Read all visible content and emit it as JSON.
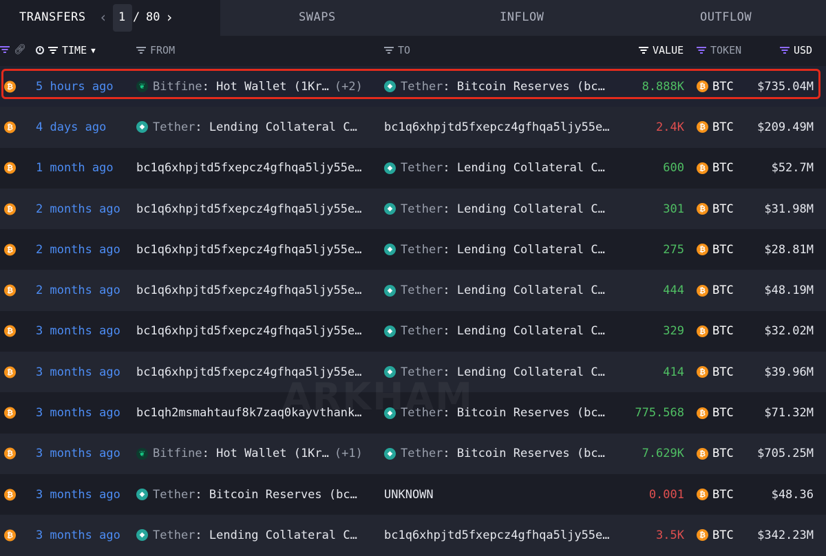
{
  "tabs": {
    "transfers": "TRANSFERS",
    "page_current": "1",
    "page_sep": "/",
    "page_total": "80",
    "prev_icon": "chevron-left-icon",
    "next_icon": "chevron-right-icon",
    "swaps": "SWAPS",
    "inflow": "INFLOW",
    "outflow": "OUTFLOW"
  },
  "header": {
    "time": "TIME",
    "from": "FROM",
    "to": "TO",
    "value": "VALUE",
    "token": "TOKEN",
    "usd": "USD"
  },
  "watermark": "ARKHAM",
  "colors": {
    "time_link": "#4d8df5",
    "positive": "#4fbf63",
    "negative": "#e04f4f",
    "btc": "#f7931a",
    "tether": "#26a59a",
    "highlight_border": "#e32b1c",
    "filter_accent": "#8f6bff"
  },
  "rows": [
    {
      "time": "5 hours ago",
      "from_entity": "Bitfine",
      "from_rest": ": Hot Wallet (1Kr…",
      "from_extra": "(+2)",
      "from_icon": "bitfinex-icon",
      "to_entity": "Tether",
      "to_rest": ": Bitcoin Reserves (bc…",
      "to_icon": "tether-icon",
      "value": "8.888K",
      "value_color": "green",
      "token": "BTC",
      "usd": "$735.04M",
      "highlight": true
    },
    {
      "time": "4 days ago",
      "from_entity": "Tether",
      "from_rest": ": Lending Collateral C…",
      "from_icon": "tether-icon",
      "to_plain": "bc1q6xhpjtd5fxepcz4gfhqa5ljy55e…",
      "value": "2.4K",
      "value_color": "red",
      "token": "BTC",
      "usd": "$209.49M"
    },
    {
      "time": "1 month ago",
      "from_plain": "bc1q6xhpjtd5fxepcz4gfhqa5ljy55e…",
      "to_entity": "Tether",
      "to_rest": ": Lending Collateral C…",
      "to_icon": "tether-icon",
      "value": "600",
      "value_color": "green",
      "token": "BTC",
      "usd": "$52.7M"
    },
    {
      "time": "2 months ago",
      "from_plain": "bc1q6xhpjtd5fxepcz4gfhqa5ljy55e…",
      "to_entity": "Tether",
      "to_rest": ": Lending Collateral C…",
      "to_icon": "tether-icon",
      "value": "301",
      "value_color": "green",
      "token": "BTC",
      "usd": "$31.98M"
    },
    {
      "time": "2 months ago",
      "from_plain": "bc1q6xhpjtd5fxepcz4gfhqa5ljy55e…",
      "to_entity": "Tether",
      "to_rest": ": Lending Collateral C…",
      "to_icon": "tether-icon",
      "value": "275",
      "value_color": "green",
      "token": "BTC",
      "usd": "$28.81M"
    },
    {
      "time": "2 months ago",
      "from_plain": "bc1q6xhpjtd5fxepcz4gfhqa5ljy55e…",
      "to_entity": "Tether",
      "to_rest": ": Lending Collateral C…",
      "to_icon": "tether-icon",
      "value": "444",
      "value_color": "green",
      "token": "BTC",
      "usd": "$48.19M"
    },
    {
      "time": "3 months ago",
      "from_plain": "bc1q6xhpjtd5fxepcz4gfhqa5ljy55e…",
      "to_entity": "Tether",
      "to_rest": ": Lending Collateral C…",
      "to_icon": "tether-icon",
      "value": "329",
      "value_color": "green",
      "token": "BTC",
      "usd": "$32.02M"
    },
    {
      "time": "3 months ago",
      "from_plain": "bc1q6xhpjtd5fxepcz4gfhqa5ljy55e…",
      "to_entity": "Tether",
      "to_rest": ": Lending Collateral C…",
      "to_icon": "tether-icon",
      "value": "414",
      "value_color": "green",
      "token": "BTC",
      "usd": "$39.96M"
    },
    {
      "time": "3 months ago",
      "from_plain": "bc1qh2msmahtauf8k7zaq0kayvthank…",
      "to_entity": "Tether",
      "to_rest": ": Bitcoin Reserves (bc…",
      "to_icon": "tether-icon",
      "value": "775.568",
      "value_color": "green",
      "token": "BTC",
      "usd": "$71.32M"
    },
    {
      "time": "3 months ago",
      "from_entity": "Bitfine",
      "from_rest": ": Hot Wallet (1Kr…",
      "from_extra": "(+1)",
      "from_icon": "bitfinex-icon",
      "to_entity": "Tether",
      "to_rest": ": Bitcoin Reserves (bc…",
      "to_icon": "tether-icon",
      "value": "7.629K",
      "value_color": "green",
      "token": "BTC",
      "usd": "$705.25M"
    },
    {
      "time": "3 months ago",
      "from_entity": "Tether",
      "from_rest": ": Bitcoin Reserves (bc…",
      "from_icon": "tether-icon",
      "to_plain": "UNKNOWN",
      "value": "0.001",
      "value_color": "red",
      "token": "BTC",
      "usd": "$48.36"
    },
    {
      "time": "3 months ago",
      "from_entity": "Tether",
      "from_rest": ": Lending Collateral C…",
      "from_icon": "tether-icon",
      "to_plain": "bc1q6xhpjtd5fxepcz4gfhqa5ljy55e…",
      "value": "3.5K",
      "value_color": "red",
      "token": "BTC",
      "usd": "$342.23M"
    }
  ]
}
